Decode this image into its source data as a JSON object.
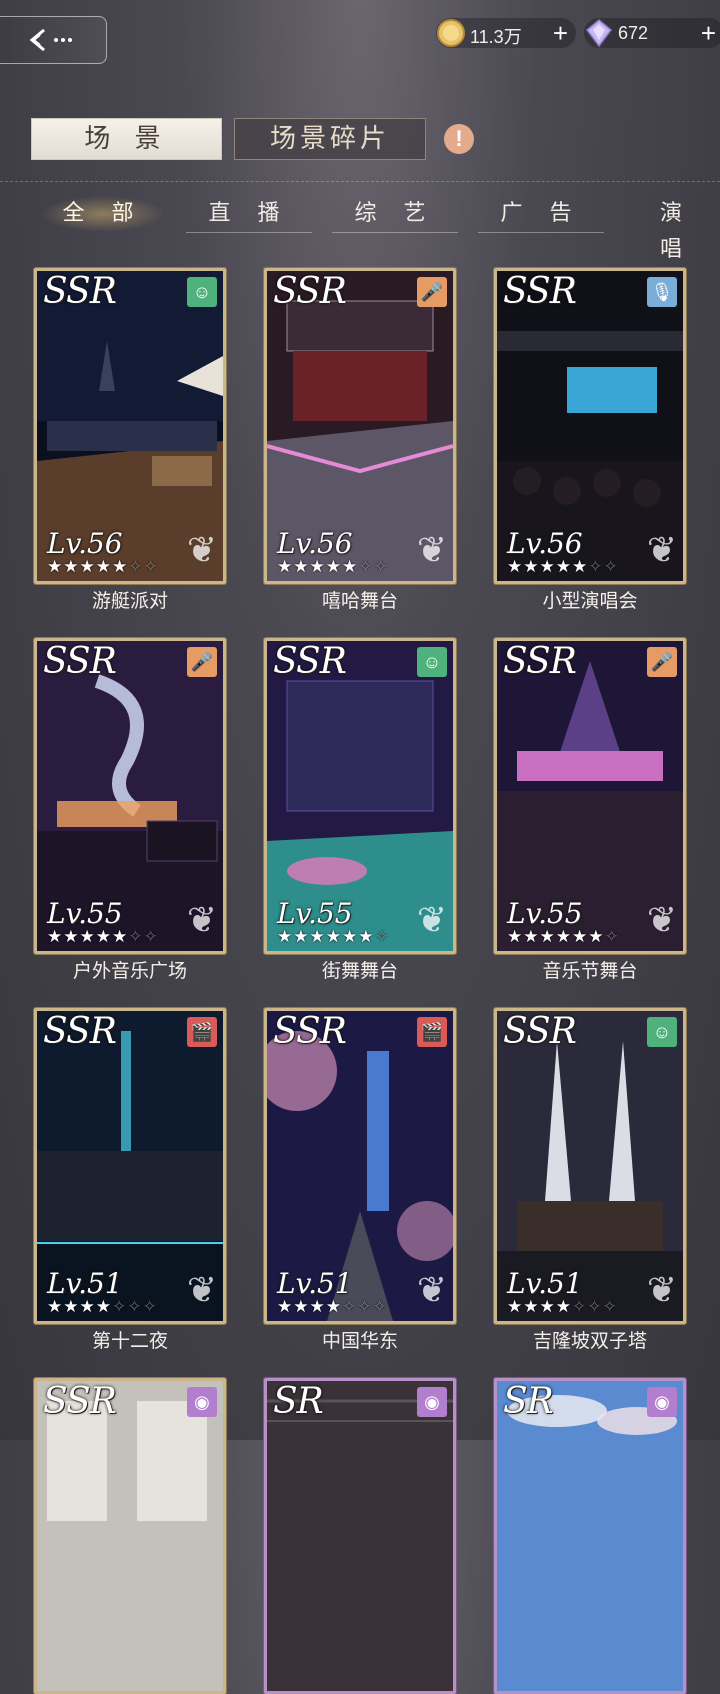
{
  "header": {
    "currencies": [
      {
        "icon": "gold-coin-icon",
        "value": "11.3万",
        "plus": "+"
      },
      {
        "icon": "diamond-icon",
        "value": "672",
        "plus": "+"
      }
    ]
  },
  "main_tabs": [
    {
      "label": "场 景",
      "active": true
    },
    {
      "label": "场景碎片",
      "active": false
    }
  ],
  "categories": [
    "全 部",
    "直 播",
    "综 艺",
    "广 告",
    "演 唱"
  ],
  "cards": [
    {
      "rarity": "SSR",
      "name": "游艇派对",
      "level": "Lv.56",
      "stars": 5,
      "max_stars": 7,
      "type_icon": "smile-icon",
      "type_color": "#4fb27d"
    },
    {
      "rarity": "SSR",
      "name": "嘻哈舞台",
      "level": "Lv.56",
      "stars": 5,
      "max_stars": 7,
      "type_icon": "microphone-icon",
      "type_color": "#e59b63"
    },
    {
      "rarity": "SSR",
      "name": "小型演唱会",
      "level": "Lv.56",
      "stars": 5,
      "max_stars": 7,
      "type_icon": "podcast-mic-icon",
      "type_color": "#7aaed8"
    },
    {
      "rarity": "SSR",
      "name": "户外音乐广场",
      "level": "Lv.55",
      "stars": 5,
      "max_stars": 7,
      "type_icon": "microphone-icon",
      "type_color": "#e59b63"
    },
    {
      "rarity": "SSR",
      "name": "街舞舞台",
      "level": "Lv.55",
      "stars": 6,
      "max_stars": 7,
      "type_icon": "smile-icon",
      "type_color": "#4fb27d"
    },
    {
      "rarity": "SSR",
      "name": "音乐节舞台",
      "level": "Lv.55",
      "stars": 6,
      "max_stars": 7,
      "type_icon": "microphone-icon",
      "type_color": "#e59b63"
    },
    {
      "rarity": "SSR",
      "name": "第十二夜",
      "level": "Lv.51",
      "stars": 4,
      "max_stars": 7,
      "type_icon": "clapperboard-icon",
      "type_color": "#d95b57"
    },
    {
      "rarity": "SSR",
      "name": "中国华东",
      "level": "Lv.51",
      "stars": 4,
      "max_stars": 7,
      "type_icon": "clapperboard-icon",
      "type_color": "#d95b57"
    },
    {
      "rarity": "SSR",
      "name": "吉隆坡双子塔",
      "level": "Lv.51",
      "stars": 4,
      "max_stars": 7,
      "type_icon": "smile-icon",
      "type_color": "#4fb27d"
    },
    {
      "rarity": "SSR",
      "name": "",
      "level": "",
      "stars": 0,
      "max_stars": 0,
      "type_icon": "camera-icon",
      "type_color": "#b27fcf"
    },
    {
      "rarity": "SR",
      "name": "",
      "level": "",
      "stars": 0,
      "max_stars": 0,
      "type_icon": "camera-icon",
      "type_color": "#b27fcf"
    },
    {
      "rarity": "SR",
      "name": "",
      "level": "",
      "stars": 0,
      "max_stars": 0,
      "type_icon": "camera-icon",
      "type_color": "#b27fcf"
    }
  ]
}
